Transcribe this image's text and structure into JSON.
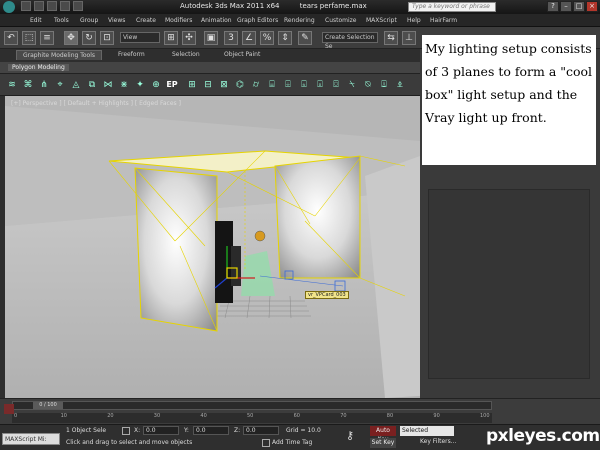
{
  "titlebar": {
    "app": "Autodesk 3ds Max  2011 x64",
    "file": "tears perfame.max",
    "search_placeholder": "Type a keyword or phrase"
  },
  "menu": [
    "Edit",
    "Tools",
    "Group",
    "Views",
    "Create",
    "Modifiers",
    "Animation",
    "Graph Editors",
    "Rendering",
    "Customize",
    "MAXScript",
    "Help",
    "HairFarm"
  ],
  "toolbar": {
    "view_dropdown": "View",
    "selection_set": "Create Selection Se"
  },
  "ribbon": {
    "tabs": [
      "Graphite Modeling Tools",
      "Freeform",
      "Selection",
      "Object Paint"
    ],
    "subtab": "Polygon Modeling",
    "ep_label": "EP"
  },
  "viewport": {
    "label": "[+] Perspective ] [ Default + Highlights ] [ Edged Faces ]",
    "object_label": "vr_VPCard_003"
  },
  "tutorial": {
    "text": "My lighting setup consists of 3 planes to form a \"cool box\" light setup and the Vray light up front."
  },
  "timeline": {
    "frame": "0 / 100",
    "ticks": [
      "0",
      "10",
      "20",
      "30",
      "40",
      "50",
      "60",
      "70",
      "80",
      "90",
      "100"
    ]
  },
  "status": {
    "maxscript": "MAXScript Mi:",
    "selection": "1 Object Sele",
    "prompt": "Click and drag to select and move objects",
    "x_label": "X:",
    "x_value": "0.0",
    "y_label": "Y:",
    "y_value": "0.0",
    "z_label": "Z:",
    "z_value": "0.0",
    "grid": "Grid = 10.0",
    "add_time_tag": "Add Time Tag",
    "auto_key": "Auto Key",
    "set_key": "Set Key",
    "selected": "Selected",
    "key_filters": "Key Filters..."
  },
  "watermark": "pxleyes.com"
}
